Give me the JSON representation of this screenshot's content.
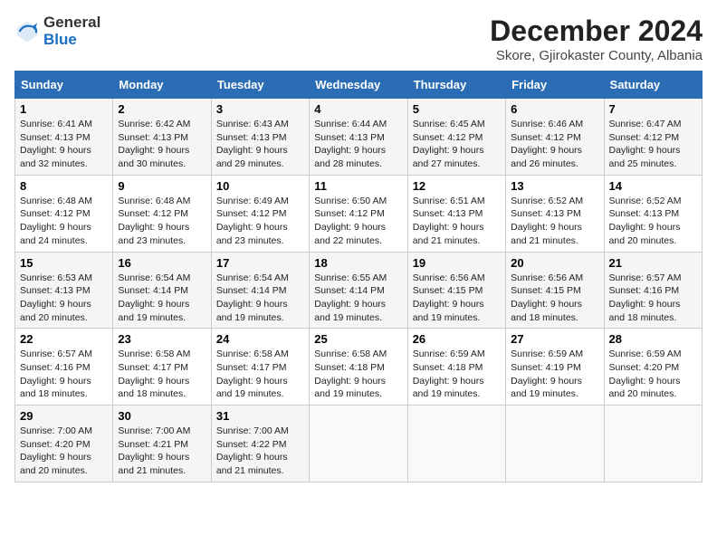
{
  "header": {
    "logo_general": "General",
    "logo_blue": "Blue",
    "title": "December 2024",
    "subtitle": "Skore, Gjirokaster County, Albania"
  },
  "columns": [
    "Sunday",
    "Monday",
    "Tuesday",
    "Wednesday",
    "Thursday",
    "Friday",
    "Saturday"
  ],
  "weeks": [
    [
      {
        "day": "1",
        "sunrise": "Sunrise: 6:41 AM",
        "sunset": "Sunset: 4:13 PM",
        "daylight": "Daylight: 9 hours and 32 minutes."
      },
      {
        "day": "2",
        "sunrise": "Sunrise: 6:42 AM",
        "sunset": "Sunset: 4:13 PM",
        "daylight": "Daylight: 9 hours and 30 minutes."
      },
      {
        "day": "3",
        "sunrise": "Sunrise: 6:43 AM",
        "sunset": "Sunset: 4:13 PM",
        "daylight": "Daylight: 9 hours and 29 minutes."
      },
      {
        "day": "4",
        "sunrise": "Sunrise: 6:44 AM",
        "sunset": "Sunset: 4:13 PM",
        "daylight": "Daylight: 9 hours and 28 minutes."
      },
      {
        "day": "5",
        "sunrise": "Sunrise: 6:45 AM",
        "sunset": "Sunset: 4:12 PM",
        "daylight": "Daylight: 9 hours and 27 minutes."
      },
      {
        "day": "6",
        "sunrise": "Sunrise: 6:46 AM",
        "sunset": "Sunset: 4:12 PM",
        "daylight": "Daylight: 9 hours and 26 minutes."
      },
      {
        "day": "7",
        "sunrise": "Sunrise: 6:47 AM",
        "sunset": "Sunset: 4:12 PM",
        "daylight": "Daylight: 9 hours and 25 minutes."
      }
    ],
    [
      {
        "day": "8",
        "sunrise": "Sunrise: 6:48 AM",
        "sunset": "Sunset: 4:12 PM",
        "daylight": "Daylight: 9 hours and 24 minutes."
      },
      {
        "day": "9",
        "sunrise": "Sunrise: 6:48 AM",
        "sunset": "Sunset: 4:12 PM",
        "daylight": "Daylight: 9 hours and 23 minutes."
      },
      {
        "day": "10",
        "sunrise": "Sunrise: 6:49 AM",
        "sunset": "Sunset: 4:12 PM",
        "daylight": "Daylight: 9 hours and 23 minutes."
      },
      {
        "day": "11",
        "sunrise": "Sunrise: 6:50 AM",
        "sunset": "Sunset: 4:12 PM",
        "daylight": "Daylight: 9 hours and 22 minutes."
      },
      {
        "day": "12",
        "sunrise": "Sunrise: 6:51 AM",
        "sunset": "Sunset: 4:13 PM",
        "daylight": "Daylight: 9 hours and 21 minutes."
      },
      {
        "day": "13",
        "sunrise": "Sunrise: 6:52 AM",
        "sunset": "Sunset: 4:13 PM",
        "daylight": "Daylight: 9 hours and 21 minutes."
      },
      {
        "day": "14",
        "sunrise": "Sunrise: 6:52 AM",
        "sunset": "Sunset: 4:13 PM",
        "daylight": "Daylight: 9 hours and 20 minutes."
      }
    ],
    [
      {
        "day": "15",
        "sunrise": "Sunrise: 6:53 AM",
        "sunset": "Sunset: 4:13 PM",
        "daylight": "Daylight: 9 hours and 20 minutes."
      },
      {
        "day": "16",
        "sunrise": "Sunrise: 6:54 AM",
        "sunset": "Sunset: 4:14 PM",
        "daylight": "Daylight: 9 hours and 19 minutes."
      },
      {
        "day": "17",
        "sunrise": "Sunrise: 6:54 AM",
        "sunset": "Sunset: 4:14 PM",
        "daylight": "Daylight: 9 hours and 19 minutes."
      },
      {
        "day": "18",
        "sunrise": "Sunrise: 6:55 AM",
        "sunset": "Sunset: 4:14 PM",
        "daylight": "Daylight: 9 hours and 19 minutes."
      },
      {
        "day": "19",
        "sunrise": "Sunrise: 6:56 AM",
        "sunset": "Sunset: 4:15 PM",
        "daylight": "Daylight: 9 hours and 19 minutes."
      },
      {
        "day": "20",
        "sunrise": "Sunrise: 6:56 AM",
        "sunset": "Sunset: 4:15 PM",
        "daylight": "Daylight: 9 hours and 18 minutes."
      },
      {
        "day": "21",
        "sunrise": "Sunrise: 6:57 AM",
        "sunset": "Sunset: 4:16 PM",
        "daylight": "Daylight: 9 hours and 18 minutes."
      }
    ],
    [
      {
        "day": "22",
        "sunrise": "Sunrise: 6:57 AM",
        "sunset": "Sunset: 4:16 PM",
        "daylight": "Daylight: 9 hours and 18 minutes."
      },
      {
        "day": "23",
        "sunrise": "Sunrise: 6:58 AM",
        "sunset": "Sunset: 4:17 PM",
        "daylight": "Daylight: 9 hours and 18 minutes."
      },
      {
        "day": "24",
        "sunrise": "Sunrise: 6:58 AM",
        "sunset": "Sunset: 4:17 PM",
        "daylight": "Daylight: 9 hours and 19 minutes."
      },
      {
        "day": "25",
        "sunrise": "Sunrise: 6:58 AM",
        "sunset": "Sunset: 4:18 PM",
        "daylight": "Daylight: 9 hours and 19 minutes."
      },
      {
        "day": "26",
        "sunrise": "Sunrise: 6:59 AM",
        "sunset": "Sunset: 4:18 PM",
        "daylight": "Daylight: 9 hours and 19 minutes."
      },
      {
        "day": "27",
        "sunrise": "Sunrise: 6:59 AM",
        "sunset": "Sunset: 4:19 PM",
        "daylight": "Daylight: 9 hours and 19 minutes."
      },
      {
        "day": "28",
        "sunrise": "Sunrise: 6:59 AM",
        "sunset": "Sunset: 4:20 PM",
        "daylight": "Daylight: 9 hours and 20 minutes."
      }
    ],
    [
      {
        "day": "29",
        "sunrise": "Sunrise: 7:00 AM",
        "sunset": "Sunset: 4:20 PM",
        "daylight": "Daylight: 9 hours and 20 minutes."
      },
      {
        "day": "30",
        "sunrise": "Sunrise: 7:00 AM",
        "sunset": "Sunset: 4:21 PM",
        "daylight": "Daylight: 9 hours and 21 minutes."
      },
      {
        "day": "31",
        "sunrise": "Sunrise: 7:00 AM",
        "sunset": "Sunset: 4:22 PM",
        "daylight": "Daylight: 9 hours and 21 minutes."
      },
      null,
      null,
      null,
      null
    ]
  ]
}
